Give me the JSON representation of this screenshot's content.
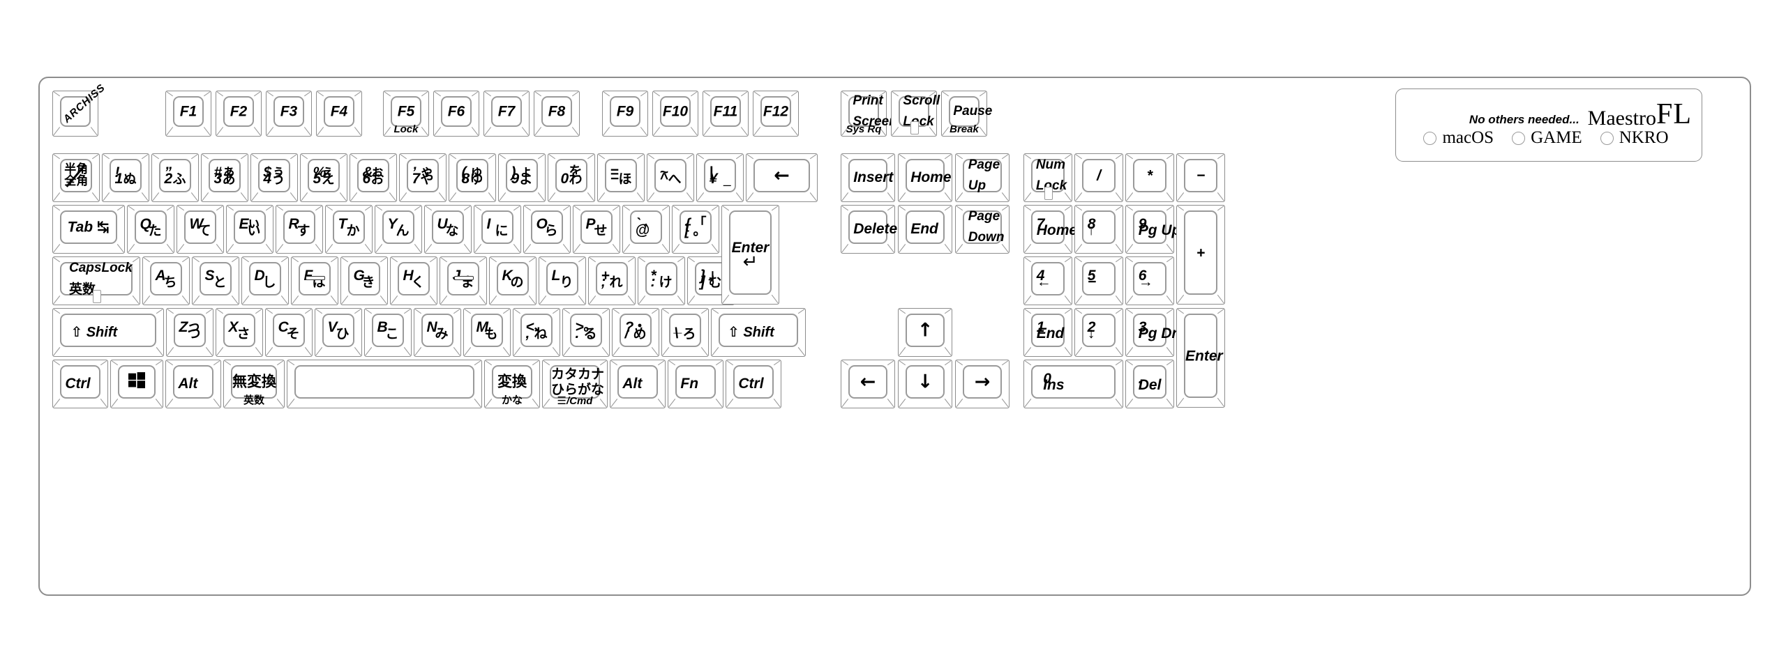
{
  "product": {
    "brand": "ARCHISS",
    "tagline": "No others needed...",
    "model_name": "Maestro",
    "model_suffix": "FL",
    "indicators": [
      {
        "name": "macOS"
      },
      {
        "name": "GAME"
      },
      {
        "name": "NKRO"
      }
    ]
  },
  "rows": {
    "function_row": [
      {
        "name": "escape-logo",
        "logo": "ARCHISS"
      },
      {
        "name": "f1",
        "center": "F1"
      },
      {
        "name": "f2",
        "center": "F2"
      },
      {
        "name": "f3",
        "center": "F3"
      },
      {
        "name": "f4",
        "center": "F4"
      },
      {
        "name": "f5",
        "center": "F5",
        "front": "Lock"
      },
      {
        "name": "f6",
        "center": "F6"
      },
      {
        "name": "f7",
        "center": "F7"
      },
      {
        "name": "f8",
        "center": "F8"
      },
      {
        "name": "f9",
        "center": "F9"
      },
      {
        "name": "f10",
        "center": "F10"
      },
      {
        "name": "f11",
        "center": "F11"
      },
      {
        "name": "f12",
        "center": "F12"
      }
    ],
    "nav_top": [
      {
        "name": "print-screen",
        "line1": "Print",
        "line2": "Screen",
        "front": "Sys Rq"
      },
      {
        "name": "scroll-lock",
        "line1": "Scroll",
        "line2": "Lock",
        "led": true
      },
      {
        "name": "pause",
        "line1": "Pause",
        "front": "Break"
      }
    ],
    "number_row": [
      {
        "name": "hankaku-zenkaku",
        "jp_top": "半角",
        "jp_bottom": "全角",
        "slash": true
      },
      {
        "name": "digit-1",
        "tl": "!",
        "bl": "1",
        "br": "ぬ"
      },
      {
        "name": "digit-2",
        "tl": "”",
        "bl": "2",
        "br": "ふ"
      },
      {
        "name": "digit-3",
        "tl": "#",
        "bl": "3",
        "tr": "ぁ",
        "br": "あ"
      },
      {
        "name": "digit-4",
        "tl": "$",
        "bl": "4",
        "tr": "ぅ",
        "br": "う"
      },
      {
        "name": "digit-5",
        "tl": "%",
        "bl": "5",
        "tr": "ぇ",
        "br": "え"
      },
      {
        "name": "digit-6",
        "tl": "&",
        "bl": "6",
        "tr": "ぉ",
        "br": "お"
      },
      {
        "name": "digit-7",
        "tl": "’",
        "bl": "7",
        "tr": "ゃ",
        "br": "や"
      },
      {
        "name": "digit-8",
        "tl": "(",
        "bl": "8",
        "tr": "ゅ",
        "br": "ゆ"
      },
      {
        "name": "digit-9",
        "tl": ")",
        "bl": "9",
        "tr": "ょ",
        "br": "よ"
      },
      {
        "name": "digit-0",
        "bl": "0",
        "tr": "を",
        "br": "わ"
      },
      {
        "name": "minus",
        "tl": "=",
        "bl": "−",
        "br": "ほ"
      },
      {
        "name": "caret",
        "tl": "~",
        "bl": "^",
        "br": "へ"
      },
      {
        "name": "yen",
        "tl": "|",
        "bl": "¥",
        "br": "_"
      },
      {
        "name": "backspace",
        "center": "←"
      }
    ],
    "nav_mid": [
      {
        "name": "insert",
        "center": "Insert"
      },
      {
        "name": "home",
        "center": "Home"
      },
      {
        "name": "page-up",
        "line1": "Page",
        "line2": "Up"
      },
      {
        "name": "delete",
        "center": "Delete"
      },
      {
        "name": "end",
        "center": "End"
      },
      {
        "name": "page-down",
        "line1": "Page",
        "line2": "Down"
      }
    ],
    "qwerty_row": [
      {
        "name": "tab",
        "center": "Tab",
        "icon": "tab-arrows-icon"
      },
      {
        "name": "key-q",
        "tl": "Q",
        "br": "た"
      },
      {
        "name": "key-w",
        "tl": "W",
        "br": "て"
      },
      {
        "name": "key-e",
        "tl": "E",
        "tr": "ぃ",
        "br": "い"
      },
      {
        "name": "key-r",
        "tl": "R",
        "br": "す"
      },
      {
        "name": "key-t",
        "tl": "T",
        "br": "か"
      },
      {
        "name": "key-y",
        "tl": "Y",
        "br": "ん"
      },
      {
        "name": "key-u",
        "tl": "U",
        "br": "な"
      },
      {
        "name": "key-i",
        "tl": "I",
        "br": "に"
      },
      {
        "name": "key-o",
        "tl": "O",
        "br": "ら"
      },
      {
        "name": "key-p",
        "tl": "P",
        "br": "せ"
      },
      {
        "name": "at",
        "tl": "`",
        "bl": "@",
        "br": "゛"
      },
      {
        "name": "bracket-left",
        "tl": "{",
        "bl": "[",
        "tr": "「",
        "br": "。"
      },
      {
        "name": "enter",
        "center": "Enter",
        "icon": "enter-arrow-icon"
      }
    ],
    "home_row": [
      {
        "name": "caps-lock",
        "line1": "CapsLock",
        "line2": "英数",
        "led": true
      },
      {
        "name": "key-a",
        "tl": "A",
        "br": "ち"
      },
      {
        "name": "key-s",
        "tl": "S",
        "br": "と"
      },
      {
        "name": "key-d",
        "tl": "D",
        "br": "し"
      },
      {
        "name": "key-f",
        "tl": "F",
        "br": "は",
        "homing": true
      },
      {
        "name": "key-g",
        "tl": "G",
        "br": "き"
      },
      {
        "name": "key-h",
        "tl": "H",
        "br": "く"
      },
      {
        "name": "key-j",
        "tl": "J",
        "br": "ま",
        "homing": true
      },
      {
        "name": "key-k",
        "tl": "K",
        "br": "の"
      },
      {
        "name": "key-l",
        "tl": "L",
        "br": "り"
      },
      {
        "name": "semicolon",
        "tl": "+",
        "bl": ";",
        "br": "れ"
      },
      {
        "name": "colon",
        "tl": "*",
        "bl": ":",
        "br": "け"
      },
      {
        "name": "bracket-right",
        "tl": "}",
        "bl": "]",
        "tr": "」",
        "br": "む"
      }
    ],
    "shift_row": [
      {
        "name": "shift-left",
        "center": "Shift",
        "icon": "shift-up-icon"
      },
      {
        "name": "key-z",
        "tl": "Z",
        "tr": "っ",
        "br": "つ"
      },
      {
        "name": "key-x",
        "tl": "X",
        "br": "さ"
      },
      {
        "name": "key-c",
        "tl": "C",
        "br": "そ"
      },
      {
        "name": "key-v",
        "tl": "V",
        "br": "ひ"
      },
      {
        "name": "key-b",
        "tl": "B",
        "br": "こ"
      },
      {
        "name": "key-n",
        "tl": "N",
        "br": "み"
      },
      {
        "name": "key-m",
        "tl": "M",
        "br": "も"
      },
      {
        "name": "comma",
        "tl": "<",
        "bl": ",",
        "tr": "、",
        "br": "ね"
      },
      {
        "name": "period",
        "tl": ">",
        "bl": ".",
        "tr": "。",
        "br": "る"
      },
      {
        "name": "slash",
        "tl": "?",
        "bl": "/",
        "tr": "・",
        "br": "め"
      },
      {
        "name": "ro",
        "tl": "_",
        "bl": "\\",
        "br": "ろ"
      },
      {
        "name": "shift-right",
        "center": "Shift",
        "icon": "shift-up-icon"
      }
    ],
    "arrows": [
      {
        "name": "arrow-up",
        "center": "↑"
      },
      {
        "name": "arrow-left",
        "center": "←"
      },
      {
        "name": "arrow-down",
        "center": "↓"
      },
      {
        "name": "arrow-right",
        "center": "→"
      }
    ],
    "bottom_row": [
      {
        "name": "ctrl-left",
        "center": "Ctrl"
      },
      {
        "name": "windows-key",
        "icon": "windows-logo-icon"
      },
      {
        "name": "alt-left",
        "center": "Alt"
      },
      {
        "name": "muhenkan",
        "center": "無変換",
        "front": "英数"
      },
      {
        "name": "space",
        "center": ""
      },
      {
        "name": "henkan",
        "center": "変換",
        "front": "かな"
      },
      {
        "name": "katakana-hiragana",
        "line1": "カタカナ",
        "line2": "ひらがな",
        "front": "☰/Cmd"
      },
      {
        "name": "alt-right",
        "center": "Alt"
      },
      {
        "name": "fn",
        "center": "Fn"
      },
      {
        "name": "ctrl-right",
        "center": "Ctrl"
      }
    ],
    "numpad": [
      {
        "name": "num-lock",
        "line1": "Num",
        "line2": "Lock",
        "led": true
      },
      {
        "name": "numpad-divide",
        "center": "/"
      },
      {
        "name": "numpad-multiply",
        "center": "*"
      },
      {
        "name": "numpad-minus",
        "center": "−"
      },
      {
        "name": "numpad-7",
        "tl": "7",
        "bl": "Home"
      },
      {
        "name": "numpad-8",
        "tl": "8",
        "bl": "↑"
      },
      {
        "name": "numpad-9",
        "tl": "9",
        "bl": "Pg Up"
      },
      {
        "name": "numpad-plus",
        "center": "+"
      },
      {
        "name": "numpad-4",
        "tl": "4",
        "bl": "←"
      },
      {
        "name": "numpad-5",
        "tl": "5",
        "bl": "−"
      },
      {
        "name": "numpad-6",
        "tl": "6",
        "bl": "→"
      },
      {
        "name": "numpad-1",
        "tl": "1",
        "bl": "End"
      },
      {
        "name": "numpad-2",
        "tl": "2",
        "bl": "↓"
      },
      {
        "name": "numpad-3",
        "tl": "3",
        "bl": "Pg Dn"
      },
      {
        "name": "numpad-enter",
        "center": "Enter"
      },
      {
        "name": "numpad-0",
        "tl": "0",
        "bl": "Ins"
      },
      {
        "name": "numpad-decimal",
        "tl": ".",
        "bl": "Del"
      }
    ]
  }
}
